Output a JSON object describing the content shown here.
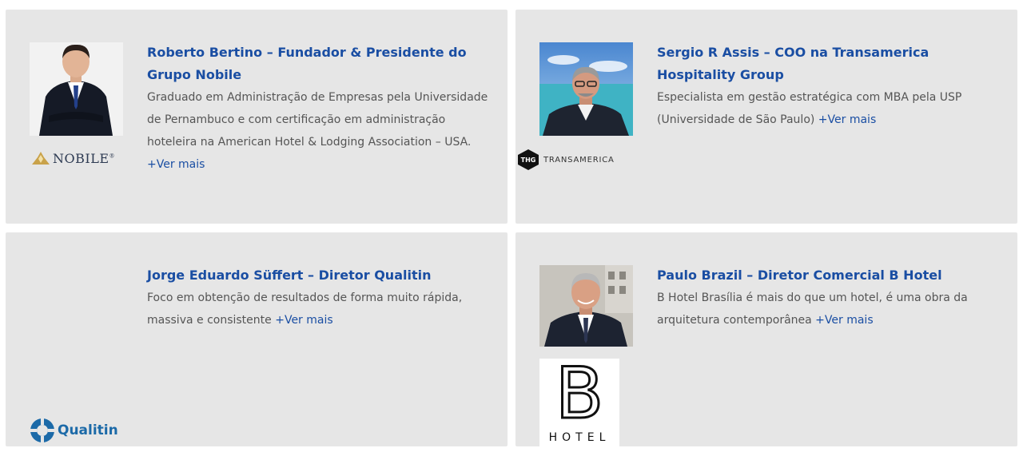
{
  "more_label": "+Ver mais",
  "cards": [
    {
      "title": "Roberto Bertino – Fundador & Presidente do Grupo Nobile",
      "description": "Graduado em Administração de Empresas pela Universidade de Pernambuco e com certificação em administração hoteleira na American Hotel & Lodging Association – USA.",
      "logo_text": "NOBILE",
      "logo_mark": "®"
    },
    {
      "title": "Sergio R Assis – COO na Transamerica Hospitality Group",
      "description": "Especialista em gestão estratégica com MBA pela USP (Universidade de São Paulo)",
      "logo_badge": "THG",
      "logo_text": "TRANSAMERICA"
    },
    {
      "title": "Jorge Eduardo Süffert – Diretor Qualitin",
      "description": "Foco em obtenção de resultados de forma muito rápida, massiva e consistente",
      "logo_text": "Qualitin"
    },
    {
      "title": "Paulo Brazil – Diretor Comercial B Hotel",
      "description": "B Hotel Brasília é mais do que um hotel, é uma obra da arquitetura contemporânea",
      "logo_letter": "B",
      "logo_text": "HOTEL"
    }
  ],
  "colors": {
    "card_background": "#e6e6e6",
    "title": "#1a4ea3",
    "body_text": "#555555",
    "link": "#1a4ea3"
  },
  "icons": [
    "nobile-crown-icon",
    "thg-badge-icon",
    "qualitin-logo-icon"
  ]
}
